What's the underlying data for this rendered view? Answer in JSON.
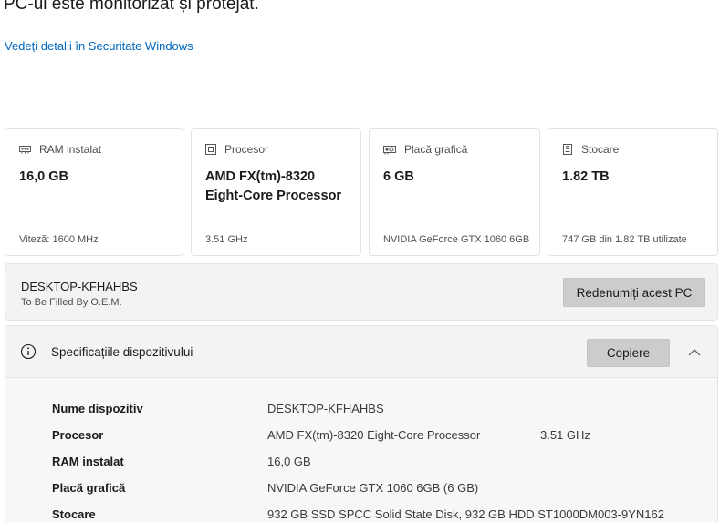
{
  "header": {
    "status_title": "PC-ul este monitorizat și protejat.",
    "security_link": "Vedeți detalii în Securitate Windows"
  },
  "cards": [
    {
      "icon": "ram-icon",
      "label": "RAM instalat",
      "value": "16,0 GB",
      "sub": "Viteză: 1600 MHz"
    },
    {
      "icon": "processor-icon",
      "label": "Procesor",
      "value": "AMD FX(tm)-8320 Eight-Core Processor",
      "sub": "3.51 GHz"
    },
    {
      "icon": "graphics-card-icon",
      "label": "Placă grafică",
      "value": "6 GB",
      "sub": "NVIDIA GeForce GTX 1060 6GB"
    },
    {
      "icon": "storage-icon",
      "label": "Stocare",
      "value": "1.82 TB",
      "sub": "747 GB din 1.82 TB utilizate"
    }
  ],
  "device": {
    "name": "DESKTOP-KFHAHBS",
    "oem": "To Be Filled By O.E.M.",
    "rename_label": "Redenumiți acest PC"
  },
  "specs": {
    "title": "Specificațiile dispozitivului",
    "copy_label": "Copiere",
    "info_icon": "info-icon",
    "collapse_icon": "chevron-up-icon",
    "rows": [
      {
        "key": "Nume dispozitiv",
        "value": "DESKTOP-KFHAHBS",
        "extra": ""
      },
      {
        "key": "Procesor",
        "value": "AMD FX(tm)-8320 Eight-Core Processor",
        "extra": "3.51 GHz"
      },
      {
        "key": "RAM instalat",
        "value": "16,0 GB",
        "extra": ""
      },
      {
        "key": "Placă grafică",
        "value": "NVIDIA GeForce GTX 1060 6GB (6 GB)",
        "extra": ""
      },
      {
        "key": "Stocare",
        "value": "932 GB SSD SPCC Solid State Disk, 932 GB HDD ST1000DM003-9YN162",
        "extra": ""
      }
    ]
  },
  "colors": {
    "link": "#0067c0",
    "button": "#cccccc",
    "panel": "#f3f3f3",
    "card_border": "#e2e2e2"
  }
}
